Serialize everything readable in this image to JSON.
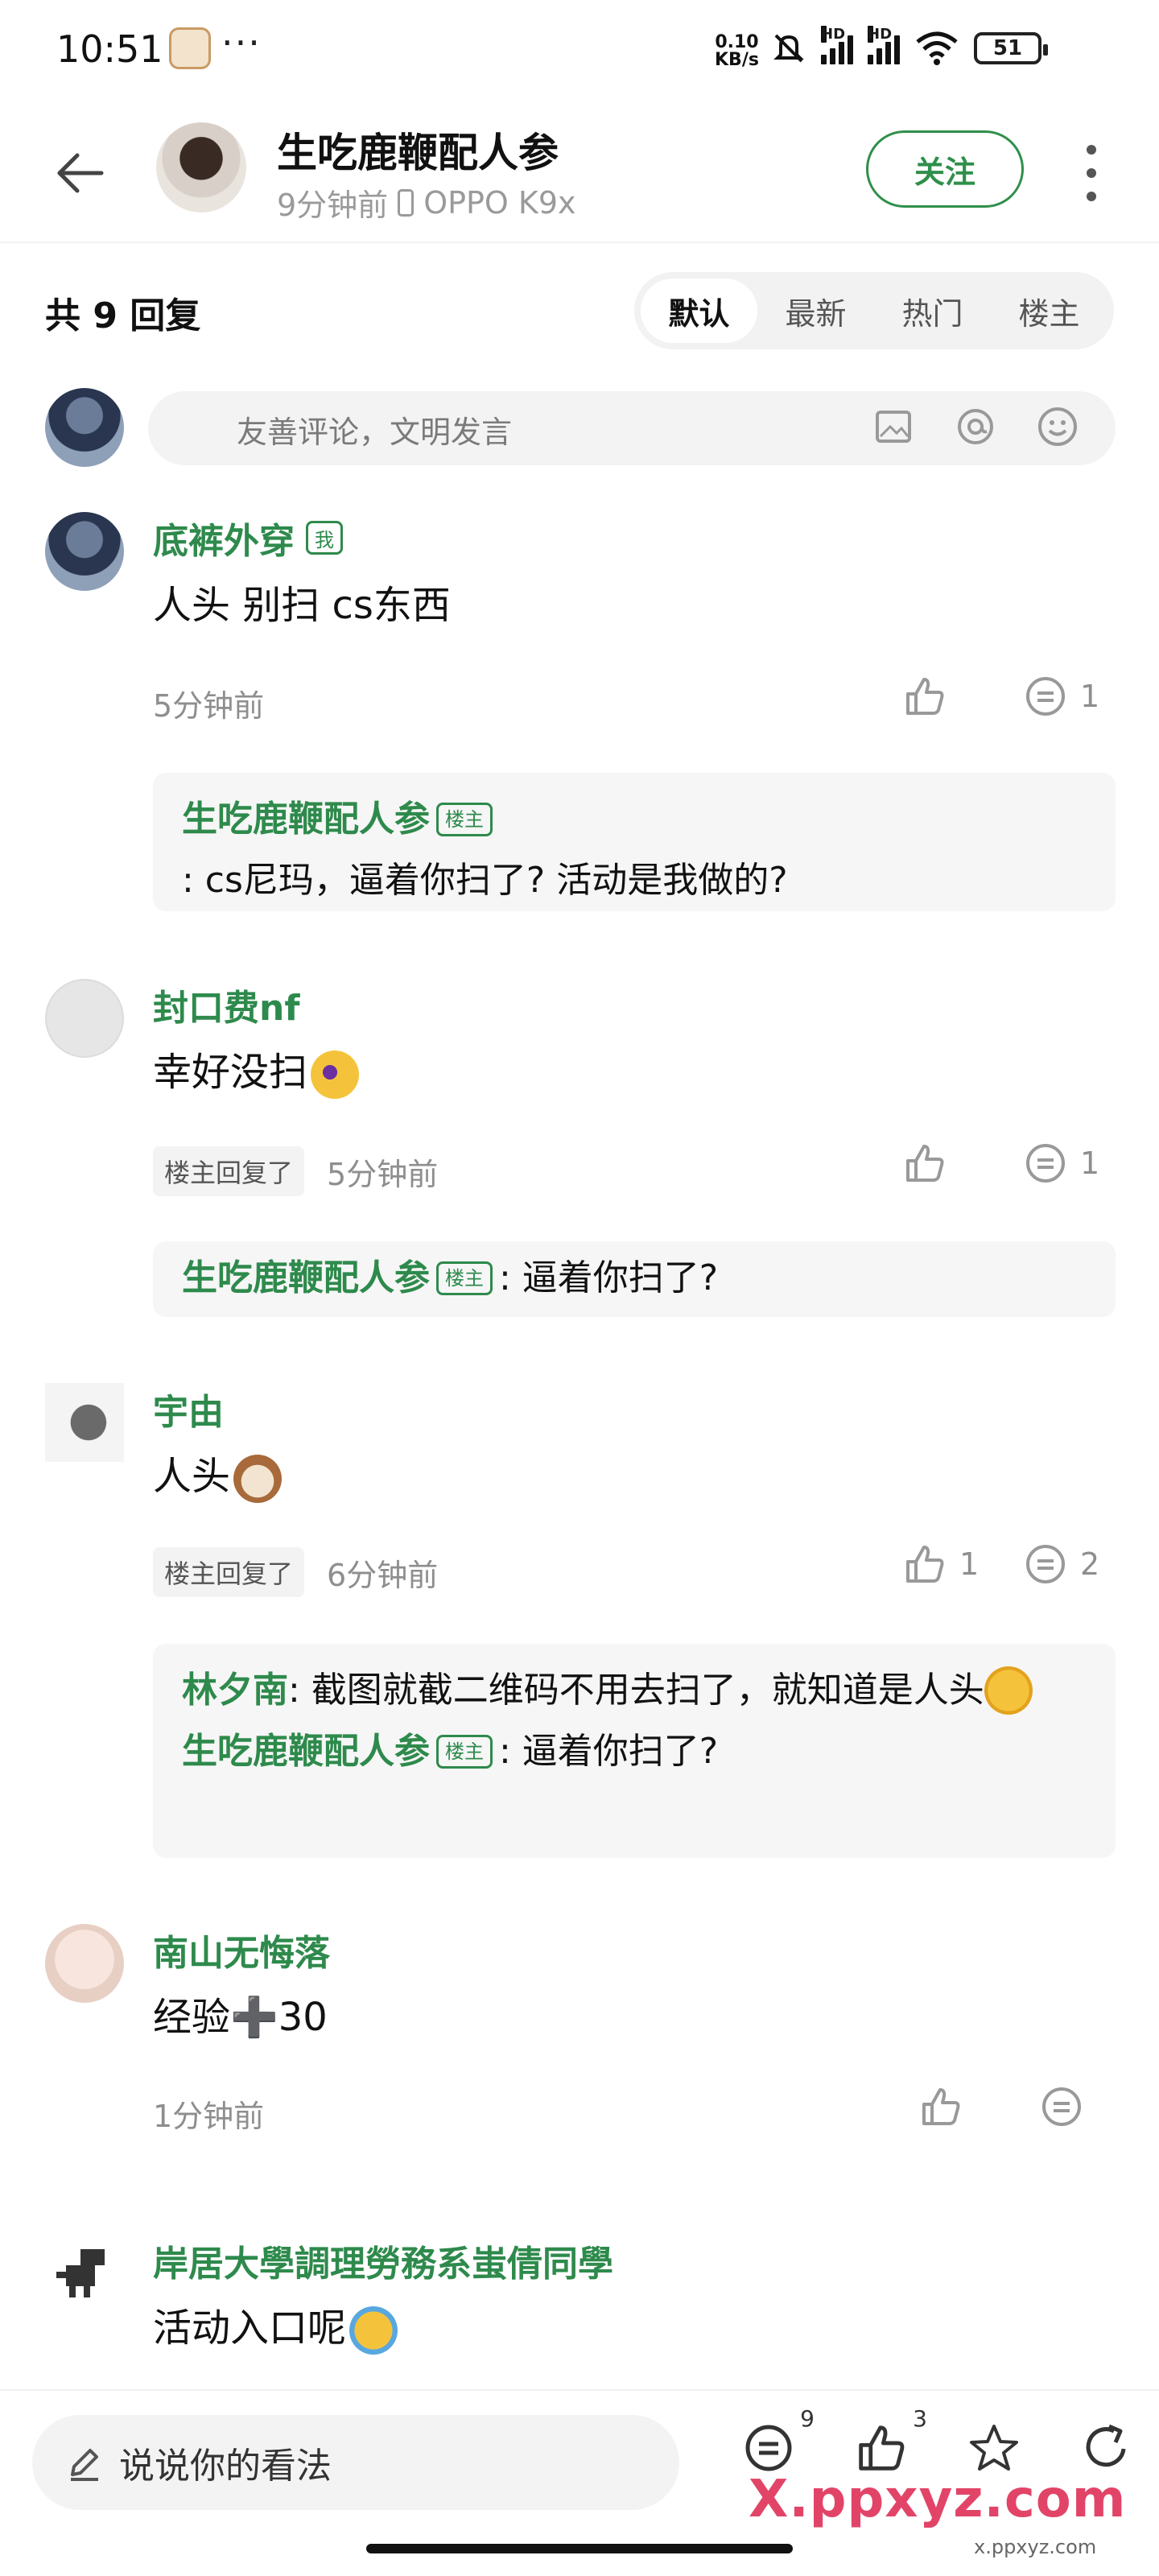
{
  "status": {
    "time": "10:51",
    "dots": "···",
    "net_speed_value": "0.10",
    "net_speed_unit": "KB/s",
    "hd1": "HD",
    "hd2": "HD",
    "battery": "51"
  },
  "header": {
    "title": "生吃鹿鞭配人参",
    "time_ago": "9分钟前",
    "device": "OPPO K9x",
    "follow_label": "关注"
  },
  "reply_count": "共 9 回复",
  "sort_tabs": [
    "默认",
    "最新",
    "热门",
    "楼主"
  ],
  "input": {
    "placeholder": "友善评论，文明发言"
  },
  "comments": [
    {
      "name": "底裤外穿",
      "badge": "我",
      "text": "人头 别扫 cs东西",
      "time": "5分钟前",
      "likes": "",
      "replies": "1",
      "sub_replies": [
        {
          "name": "生吃鹿鞭配人参",
          "badge": "楼主",
          "text": ": cs尼玛，逼着你扫了? 活动是我做的?"
        }
      ]
    },
    {
      "name": "封口费nf",
      "text": "幸好没扫",
      "op_replied": "楼主回复了",
      "time": "5分钟前",
      "likes": "",
      "replies": "1",
      "sub_replies": [
        {
          "name": "生吃鹿鞭配人参",
          "badge": "楼主",
          "text": ": 逼着你扫了?"
        }
      ]
    },
    {
      "name": "宇由",
      "text": "人头",
      "op_replied": "楼主回复了",
      "time": "6分钟前",
      "likes": "1",
      "replies": "2",
      "sub_replies": [
        {
          "name": "林夕南",
          "text": ": 截图就截二维码不用去扫了，就知道是人头"
        },
        {
          "name": "生吃鹿鞭配人参",
          "badge": "楼主",
          "text": ": 逼着你扫了?"
        }
      ]
    },
    {
      "name": "南山无悔落",
      "text": "经验➕30",
      "time": "1分钟前",
      "likes": "",
      "replies": ""
    },
    {
      "name": "岸居大學調理勞務系蚩倩同學",
      "text": "活动入口呢"
    }
  ],
  "bottom": {
    "placeholder": "说说你的看法",
    "comment_count": "9",
    "like_count": "3"
  },
  "watermark": "X.ppxyz.com",
  "watermark_sub": "x.ppxyz.com",
  "colors": {
    "accent": "#2e8a4c",
    "watermark": "#e24468"
  }
}
